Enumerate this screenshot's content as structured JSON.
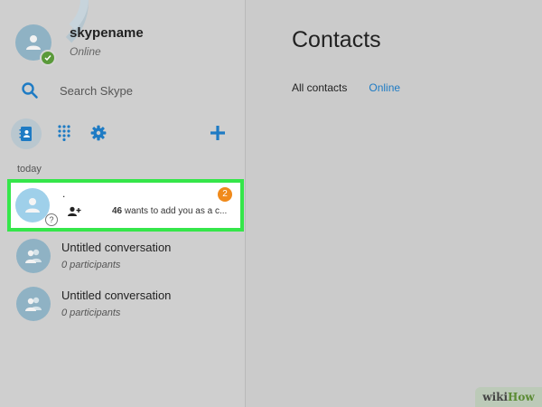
{
  "profile": {
    "name": "skypename",
    "status": "Online"
  },
  "search": {
    "placeholder": "Search Skype"
  },
  "toolbar": {
    "icons": [
      "contacts-book-icon",
      "dialpad-icon",
      "gear-icon",
      "plus-icon"
    ]
  },
  "conversations": {
    "section_label": "today",
    "request": {
      "name": ".",
      "sender_count": "46",
      "message": "wants to add you as a c...",
      "unread_count": "2"
    },
    "items": [
      {
        "title": "Untitled conversation",
        "subtitle": "0 participants"
      },
      {
        "title": "Untitled conversation",
        "subtitle": "0 participants"
      }
    ]
  },
  "main": {
    "title": "Contacts",
    "tabs": [
      {
        "label": "All contacts"
      },
      {
        "label": "Online"
      }
    ]
  },
  "watermark": {
    "part1": "wiki",
    "part2": "How"
  },
  "colors": {
    "accent": "#1e7bc4",
    "highlight_border": "#35e64a",
    "unread_badge": "#f08a1b",
    "online_status": "#5a9a3a"
  }
}
